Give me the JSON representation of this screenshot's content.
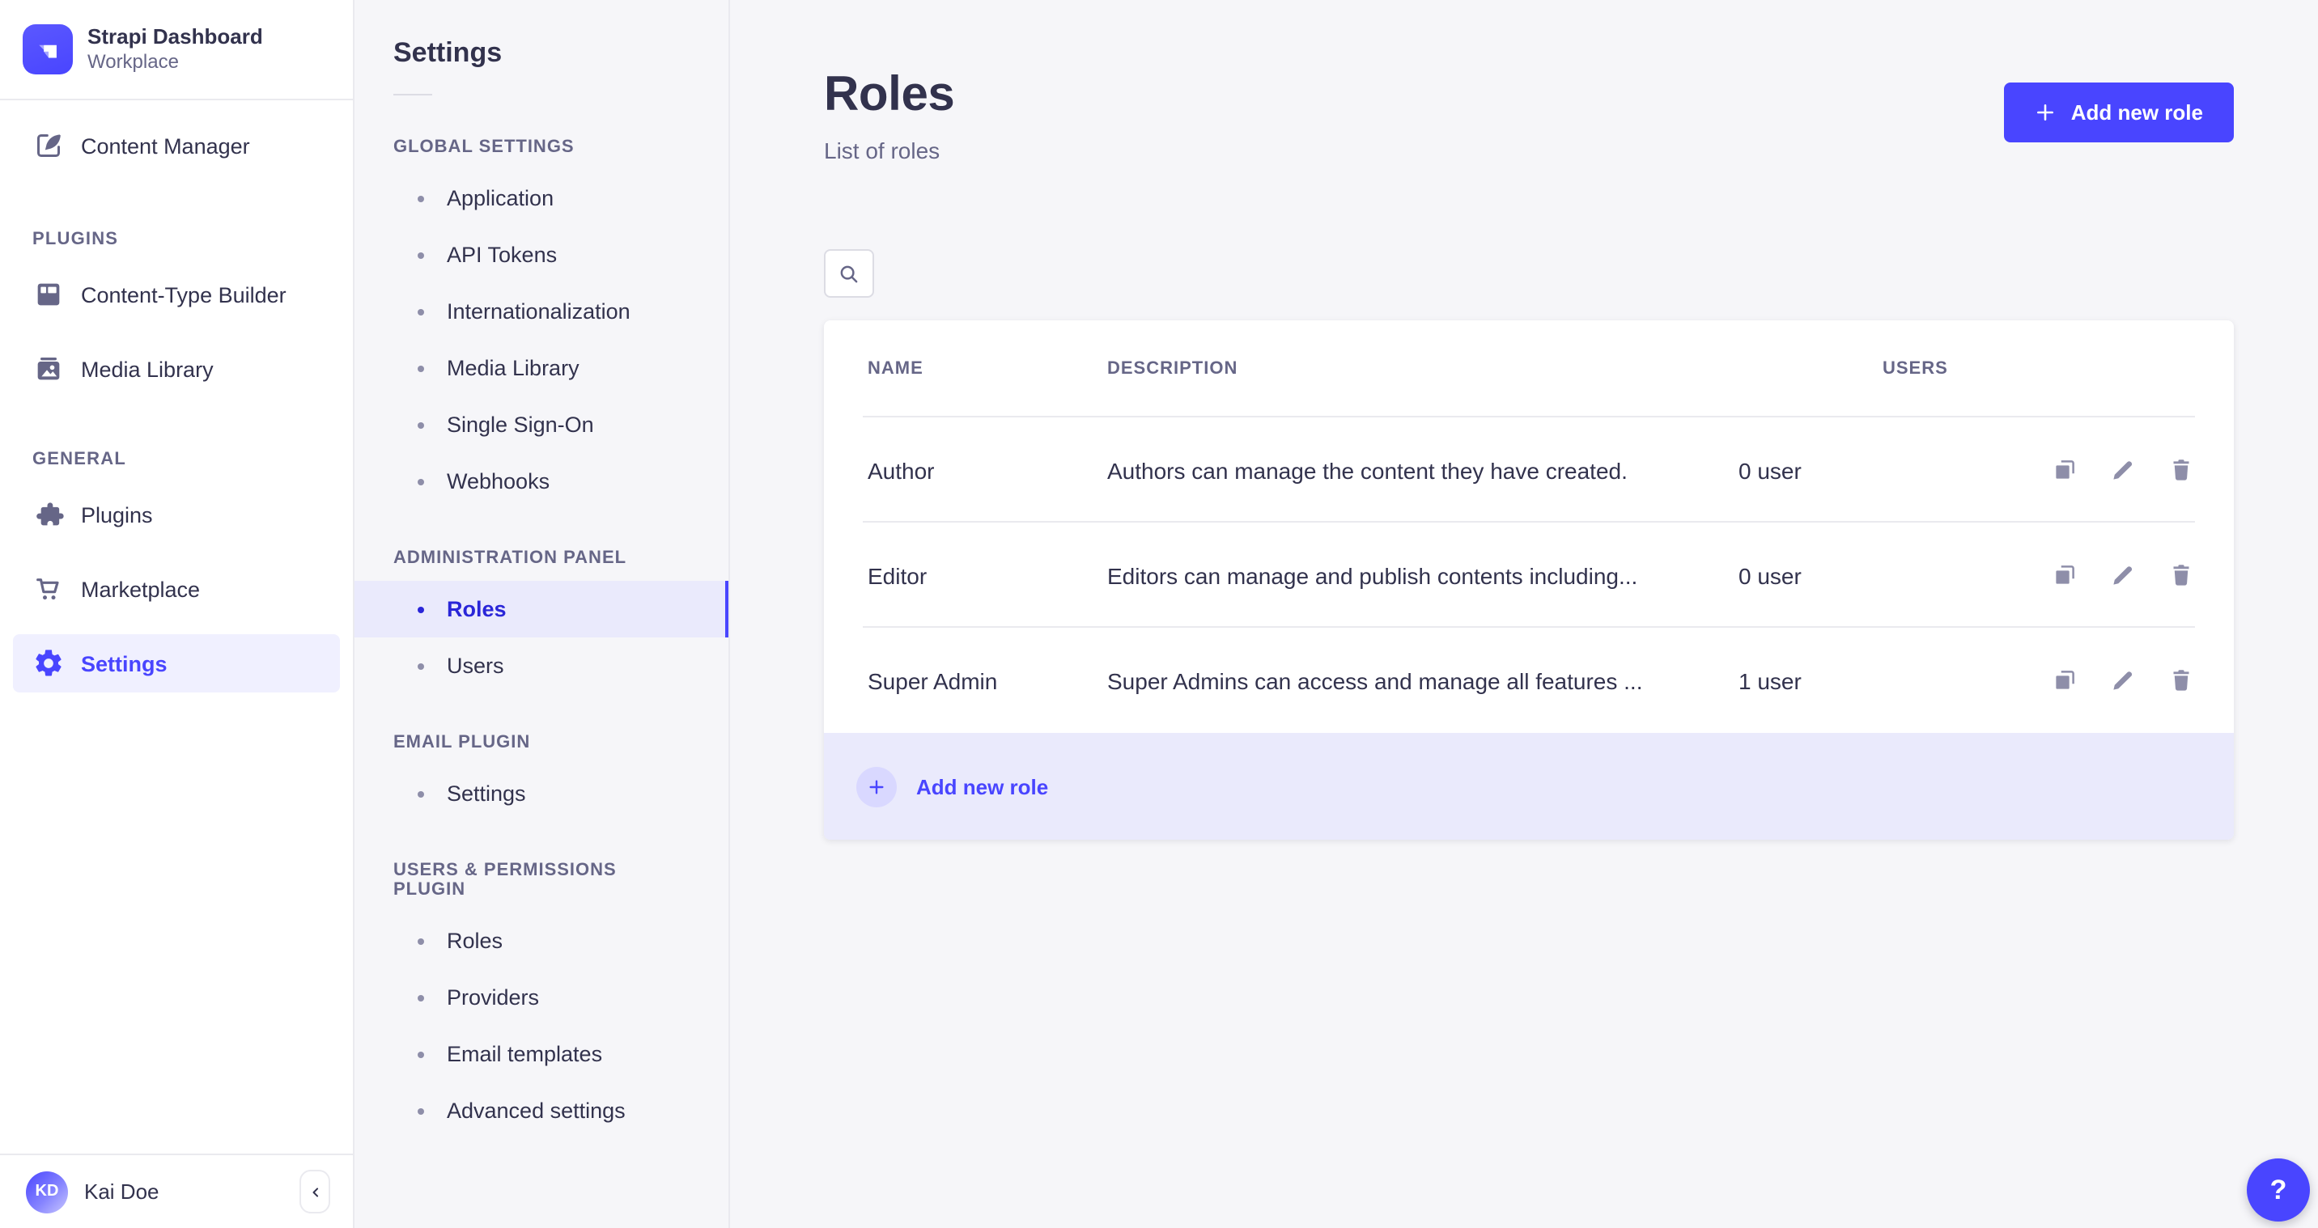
{
  "accent_color": "#4945ff",
  "brand": {
    "title": "Strapi Dashboard",
    "subtitle": "Workplace"
  },
  "sidebar": {
    "content_manager": "Content Manager",
    "plugins_header": "PLUGINS",
    "content_type_builder": "Content-Type Builder",
    "media_library": "Media Library",
    "general_header": "GENERAL",
    "plugins": "Plugins",
    "marketplace": "Marketplace",
    "settings": "Settings",
    "user_name": "Kai Doe",
    "user_initials": "KD"
  },
  "subnav": {
    "title": "Settings",
    "sections": [
      {
        "label": "GLOBAL SETTINGS",
        "items": [
          {
            "label": "Application"
          },
          {
            "label": "API Tokens"
          },
          {
            "label": "Internationalization"
          },
          {
            "label": "Media Library"
          },
          {
            "label": "Single Sign-On"
          },
          {
            "label": "Webhooks"
          }
        ]
      },
      {
        "label": "ADMINISTRATION PANEL",
        "items": [
          {
            "label": "Roles"
          },
          {
            "label": "Users"
          }
        ]
      },
      {
        "label": "EMAIL PLUGIN",
        "items": [
          {
            "label": "Settings"
          }
        ]
      },
      {
        "label": "USERS & PERMISSIONS PLUGIN",
        "items": [
          {
            "label": "Roles"
          },
          {
            "label": "Providers"
          },
          {
            "label": "Email templates"
          },
          {
            "label": "Advanced settings"
          }
        ]
      }
    ]
  },
  "main": {
    "title": "Roles",
    "subtitle": "List of roles",
    "add_button_label": "Add new role",
    "table": {
      "headers": [
        "NAME",
        "DESCRIPTION",
        "USERS"
      ],
      "rows": [
        {
          "name": "Author",
          "description": "Authors can manage the content they have created.",
          "users": "0 user"
        },
        {
          "name": "Editor",
          "description": "Editors can manage and publish contents including...",
          "users": "0 user"
        },
        {
          "name": "Super Admin",
          "description": "Super Admins can access and manage all features ...",
          "users": "1 user"
        }
      ]
    },
    "footer_add_label": "Add new role",
    "help_label": "?"
  }
}
